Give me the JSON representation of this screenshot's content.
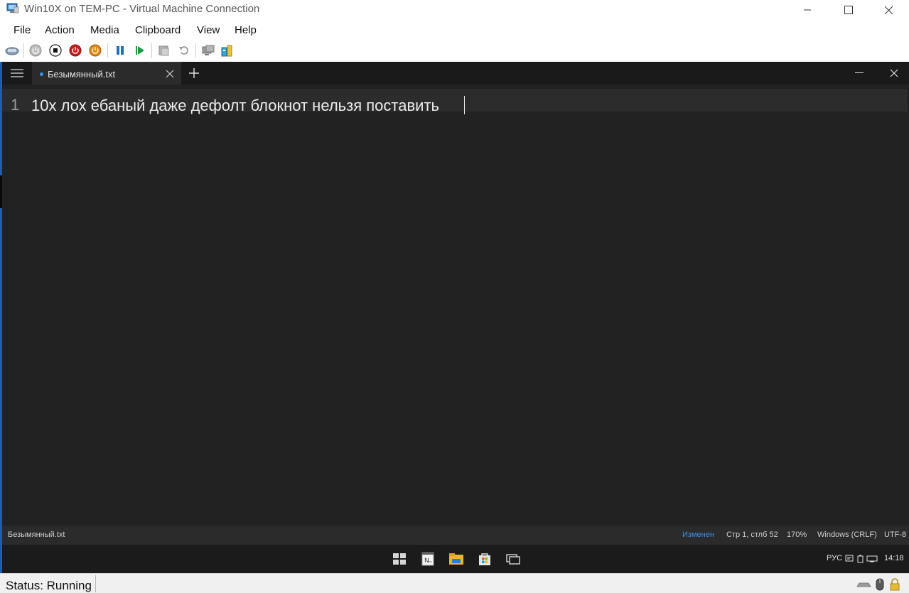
{
  "window": {
    "title": "Win10X on TEM-PC - Virtual Machine Connection"
  },
  "menu": [
    "File",
    "Action",
    "Media",
    "Clipboard",
    "View",
    "Help"
  ],
  "toolbar": {
    "buttons": [
      "ctrl-alt-del",
      "start",
      "turn-off",
      "shut-down",
      "save",
      "pause",
      "resume",
      "checkpoint",
      "revert",
      "enhanced-session",
      "share"
    ]
  },
  "editor": {
    "tab_label": "Безымянный.txt",
    "line_number": "1",
    "line_text": "10x лох ебаный даже дефолт блокнот нельзя поставить",
    "accent_color": "#3b8fe8"
  },
  "statusbar": {
    "filename": "Безымянный.txt",
    "modified": "Изменен",
    "position": "Стр 1, стлб 52",
    "zoom": "170%",
    "line_endings": "Windows (CRLF)",
    "encoding": "UTF-8"
  },
  "taskbar": {
    "icons": [
      "windows-start-icon",
      "notepad-icon",
      "file-explorer-icon",
      "store-icon",
      "task-view-icon"
    ],
    "language": "РУС",
    "time": "14:18"
  },
  "host_status": {
    "text": "Status: Running"
  }
}
